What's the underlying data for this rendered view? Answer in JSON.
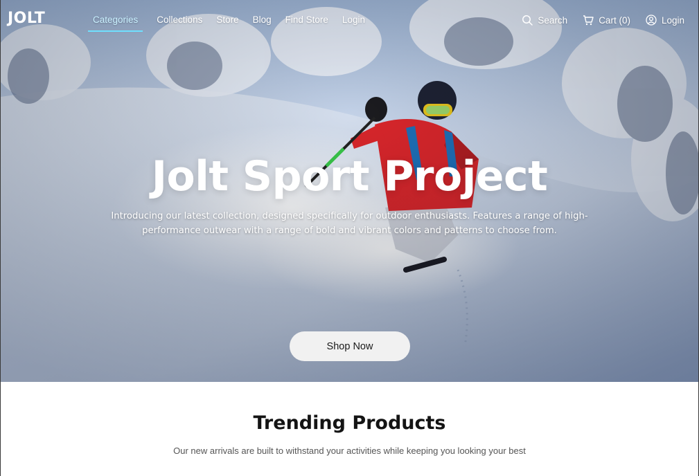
{
  "brand": {
    "logo": "JOLT"
  },
  "nav": {
    "links": [
      {
        "label": "Categories",
        "active": true
      },
      {
        "label": "Collections",
        "active": false
      },
      {
        "label": "Store",
        "active": false
      },
      {
        "label": "Blog",
        "active": false
      },
      {
        "label": "Find Store",
        "active": false
      },
      {
        "label": "Login",
        "active": false
      }
    ],
    "actions": {
      "search": {
        "label": "Search",
        "icon": "search-icon"
      },
      "cart": {
        "label": "Cart (0)",
        "icon": "cart-icon"
      },
      "login": {
        "label": "Login",
        "icon": "user-circle-icon"
      }
    },
    "accent_color": "#6fe0ff"
  },
  "hero": {
    "title": "Jolt Sport Project",
    "subtitle": "Introducing our latest collection, designed specifically for outdoor enthusiasts. Features a range of high-performance outwear with a range of bold and vibrant colors and patterns to choose from.",
    "cta_label": "Shop Now",
    "image": "skier carving through powder snow on a mountain slope with snow-covered trees"
  },
  "trending": {
    "title": "Trending Products",
    "subtitle": "Our new arrivals are built to withstand your activities while keeping you looking your best"
  }
}
